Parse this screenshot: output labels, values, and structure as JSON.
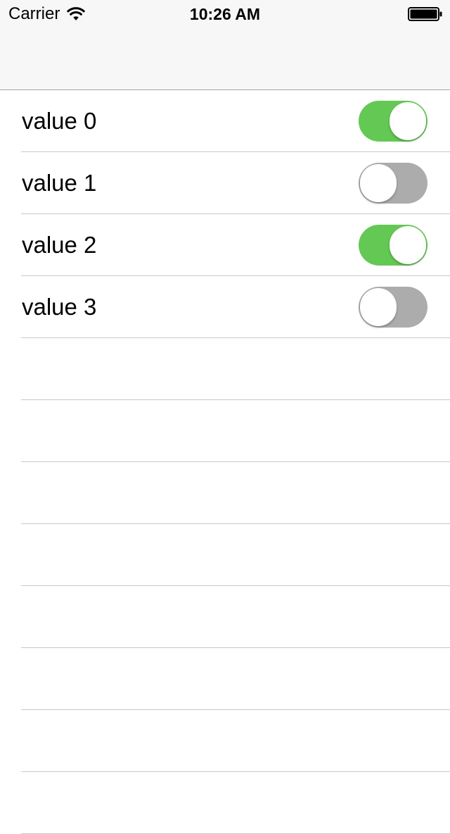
{
  "status_bar": {
    "carrier": "Carrier",
    "time": "10:26 AM",
    "wifi_icon": "wifi-icon",
    "battery_icon": "battery-icon"
  },
  "rows": [
    {
      "label": "value 0",
      "switch_on": true
    },
    {
      "label": "value 1",
      "switch_on": false
    },
    {
      "label": "value 2",
      "switch_on": true
    },
    {
      "label": "value 3",
      "switch_on": false
    }
  ],
  "empty_row_count": 8,
  "colors": {
    "switch_on": "#64c854",
    "switch_off": "#acacac",
    "separator": "#c8c7cc",
    "nav_background": "#f7f7f7"
  }
}
